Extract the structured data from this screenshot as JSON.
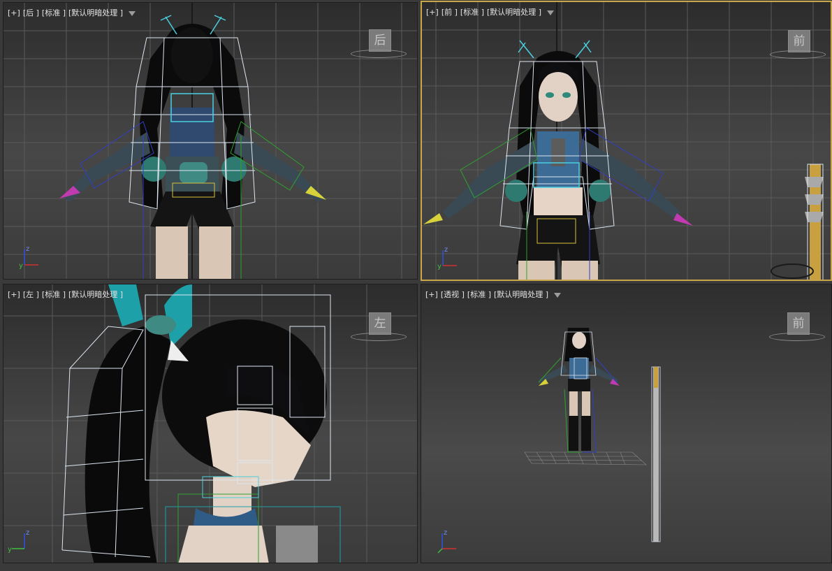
{
  "viewports": [
    {
      "id": "back",
      "labels": [
        "[+]",
        "[后 ]",
        "[标准 ]",
        "[默认明暗处理 ]"
      ],
      "cube_face": "后",
      "active": false
    },
    {
      "id": "front",
      "labels": [
        "[+]",
        "[前 ]",
        "[标准 ]",
        "[默认明暗处理 ]"
      ],
      "cube_face": "前",
      "active": true
    },
    {
      "id": "left",
      "labels": [
        "[+]",
        "[左 ]",
        "[标准 ]",
        "[默认明暗处理 ]"
      ],
      "cube_face": "左",
      "active": false
    },
    {
      "id": "perspective",
      "labels": [
        "[+]",
        "[透视 ]",
        "[标准 ]",
        "[默认明暗处理 ]"
      ],
      "cube_face": "前",
      "active": false
    }
  ],
  "axis_labels": {
    "x": "x",
    "y": "y",
    "z": "z"
  },
  "icons": {
    "filter": "filter-funnel-icon",
    "viewcube": "viewcube-icon",
    "axis": "axis-tripod-icon"
  }
}
